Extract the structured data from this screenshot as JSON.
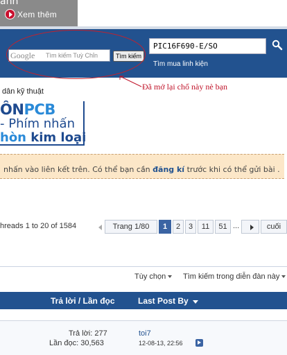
{
  "banner": {
    "partial_text": "anh",
    "xem_them_label": "Xem thêm"
  },
  "search": {
    "google_logo": "Google",
    "google_placeholder": "Tìm kiếm Tuỳ Chỉn",
    "google_button": "Tìm kiếm",
    "part_value": "PIC16F690-E/SO",
    "part_link": "Tìm mua linh kiện"
  },
  "annotation": {
    "text": "Đã mở lại chổ này nè bạn",
    "color": "#c0142a"
  },
  "forum": {
    "subtitle_fragment": "dân kỹ thuật"
  },
  "ad": {
    "line1_a": "ÔN",
    "line1_b": "PCB",
    "line2": "- Phím nhấn",
    "line3_a": "hòn",
    "line3_b": " kim loại"
  },
  "notice": {
    "pre": "nhấn vào liên kết trên. Có thể bạn cần ",
    "bold": "đăng kí",
    "post": " trước khi có thể gửi bài ."
  },
  "pagination": {
    "threads_text": "hreads 1 to 20 of 1584",
    "page_of": "Trang 1/80",
    "pages": [
      "1",
      "2",
      "3",
      "11",
      "51"
    ],
    "ellipsis": "...",
    "last": "cuối"
  },
  "toolbar": {
    "options": "Tùy chọn",
    "search_forum": "Tìm kiếm trong diễn đàn này"
  },
  "table": {
    "col_replies": "Trả lời / Lần đọc",
    "col_last_post": "Last Post By",
    "rows": [
      {
        "replies": "Trả lời: 277",
        "views": "Lần đọc: 30,563",
        "poster": "toi7",
        "date": "12-08-13, 22:56"
      }
    ]
  },
  "colors": {
    "header_blue": "#22528f",
    "accent": "#3b64a3",
    "notice_bg": "#fce7c8"
  }
}
